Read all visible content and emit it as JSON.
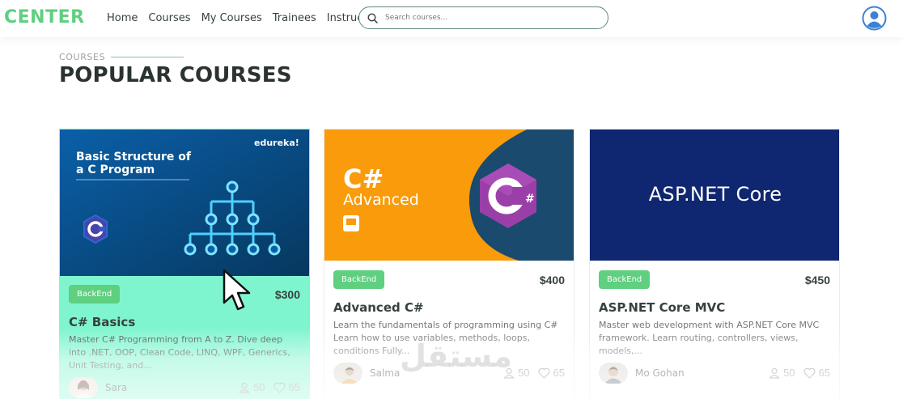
{
  "nav": {
    "brand": "CENTER",
    "links": [
      "Home",
      "Courses",
      "My Courses",
      "Trainees",
      "Instructors"
    ],
    "search_placeholder": "Search courses...",
    "search_icon": "search-icon",
    "profile_icon": "user-avatar-icon"
  },
  "section": {
    "label": "COURSES",
    "title": "POPULAR COURSES"
  },
  "colors": {
    "brand": "#5fcf80",
    "active_card": "#7ff5cf",
    "text": "#37423b"
  },
  "courses": [
    {
      "category": "BackEnd",
      "price": "$300",
      "title": "C# Basics",
      "description": "Master C# Programming from A to Z. Dive deep into .NET, OOP, Clean Code, LINQ, WPF, Generics, Unit Testing, and...",
      "trainer": "Sara",
      "students": "50",
      "likes": "65",
      "thumb": {
        "heading": "Basic Structure of a C Program",
        "brand": "edureka!"
      }
    },
    {
      "category": "BackEnd",
      "price": "$400",
      "title": "Advanced C#",
      "description": "Learn the fundamentals of programming using C# Learn how to use variables, methods, loops, conditions Fully...",
      "trainer": "Salma",
      "students": "50",
      "likes": "65",
      "thumb": {
        "heading": "C#",
        "subheading": "Advanced"
      }
    },
    {
      "category": "BackEnd",
      "price": "$450",
      "title": "ASP.NET Core MVC",
      "description": "Master web development with ASP.NET Core MVC framework. Learn routing, controllers, views, models,...",
      "trainer": "Mo Gohan",
      "students": "50",
      "likes": "65",
      "thumb": {
        "heading": "ASP.NET Core"
      }
    }
  ],
  "watermark": "مستقل"
}
